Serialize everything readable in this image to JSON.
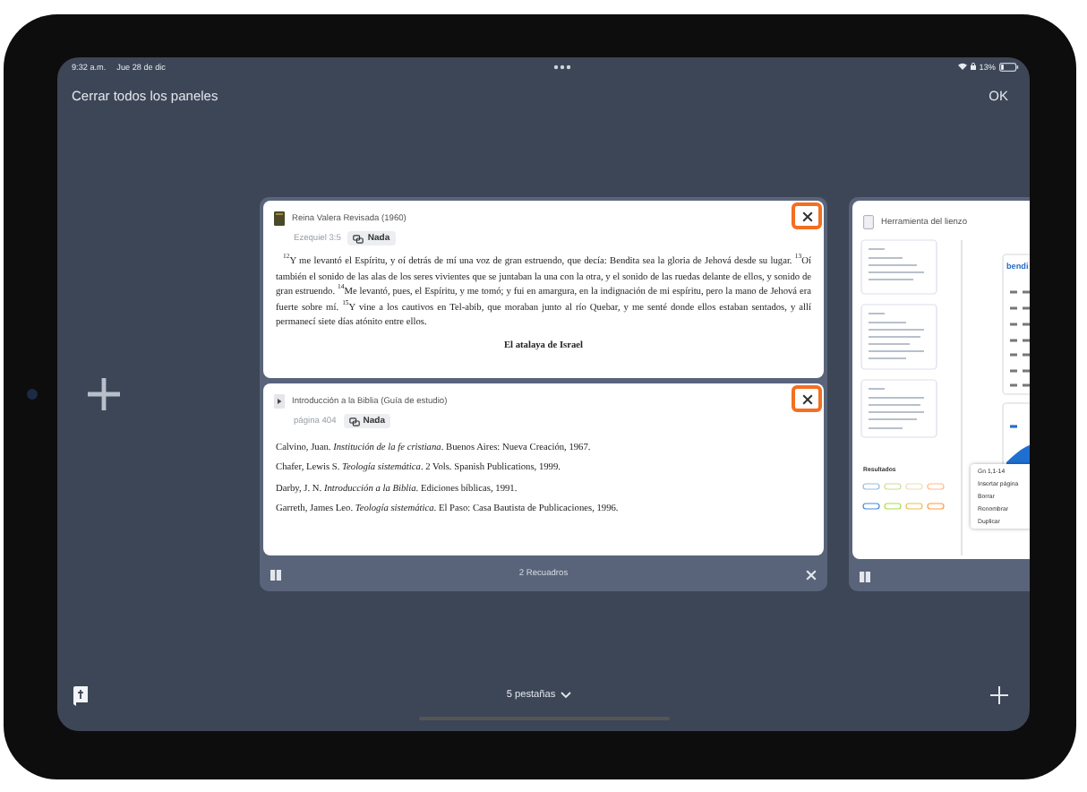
{
  "status_bar": {
    "time": "9:32 a.m.",
    "date": "Jue 28 de dic",
    "battery": "13%"
  },
  "top_bar": {
    "close_all": "Cerrar todos los paneles",
    "done": "OK"
  },
  "panel_group": {
    "panels": [
      {
        "kind": "bible",
        "title": "Reina Valera Revisada (1960)",
        "reference": "Ezequiel 3:5",
        "tag": "Nada",
        "close_highlighted": true,
        "paragraph": "$^{12}$Y me levantó el Espíritu, y oí detrás de mí una voz de gran estruendo, que decía: Bendita sea la gloria de Jehová desde su lugar. $^{13}$Oí también el sonido de las alas de los seres vivientes que se juntaban la una con la otra, y el sonido de las ruedas delante de ellos, y sonido de gran estruendo. $^{14}$Me levantó, pues, el Espíritu, y me tomó; y fui en amargura, en la indignación de mi espíritu, pero la mano de Jehová era fuerte sobre mí. $^{15}$Y vine a los cautivos en Tel-abib, que moraban junto al río Quebar, y me senté donde ellos estaban sentados, y allí permanecí siete días atónito entre ellos.",
        "heading": "El atalaya de Israel"
      },
      {
        "kind": "bibliography",
        "title": "Introducción a la Biblia (Guía de estudio)",
        "reference": "página 404",
        "tag": "Nada",
        "close_highlighted": true,
        "entries": [
          "Calvino, Juan. *Institución de la fe cristiana*. Buenos Aires: Nueva Creación, 1967.",
          "Chafer, Lewis S. *Teología sistemática*. 2 Vols. Spanish Publications, 1999.",
          "Darby, J. N. *Introducción a la Biblia*. Ediciones bíblicas, 1991.",
          "Garreth, James Leo. *Teología sistemática*. El Paso: Casa Bautista de Publicaciones, 1996."
        ]
      }
    ],
    "footer": "2 Recuadros"
  },
  "side_panel": {
    "title": "Herramienta del lienzo",
    "heading": "bendi",
    "results_label": "Resultados",
    "menu": [
      "Gn 1,1-14",
      "Insertar página",
      "Borrar",
      "Renombrar",
      "Duplicar"
    ]
  },
  "bottom_bar": {
    "tabs": "5 pestañas"
  }
}
